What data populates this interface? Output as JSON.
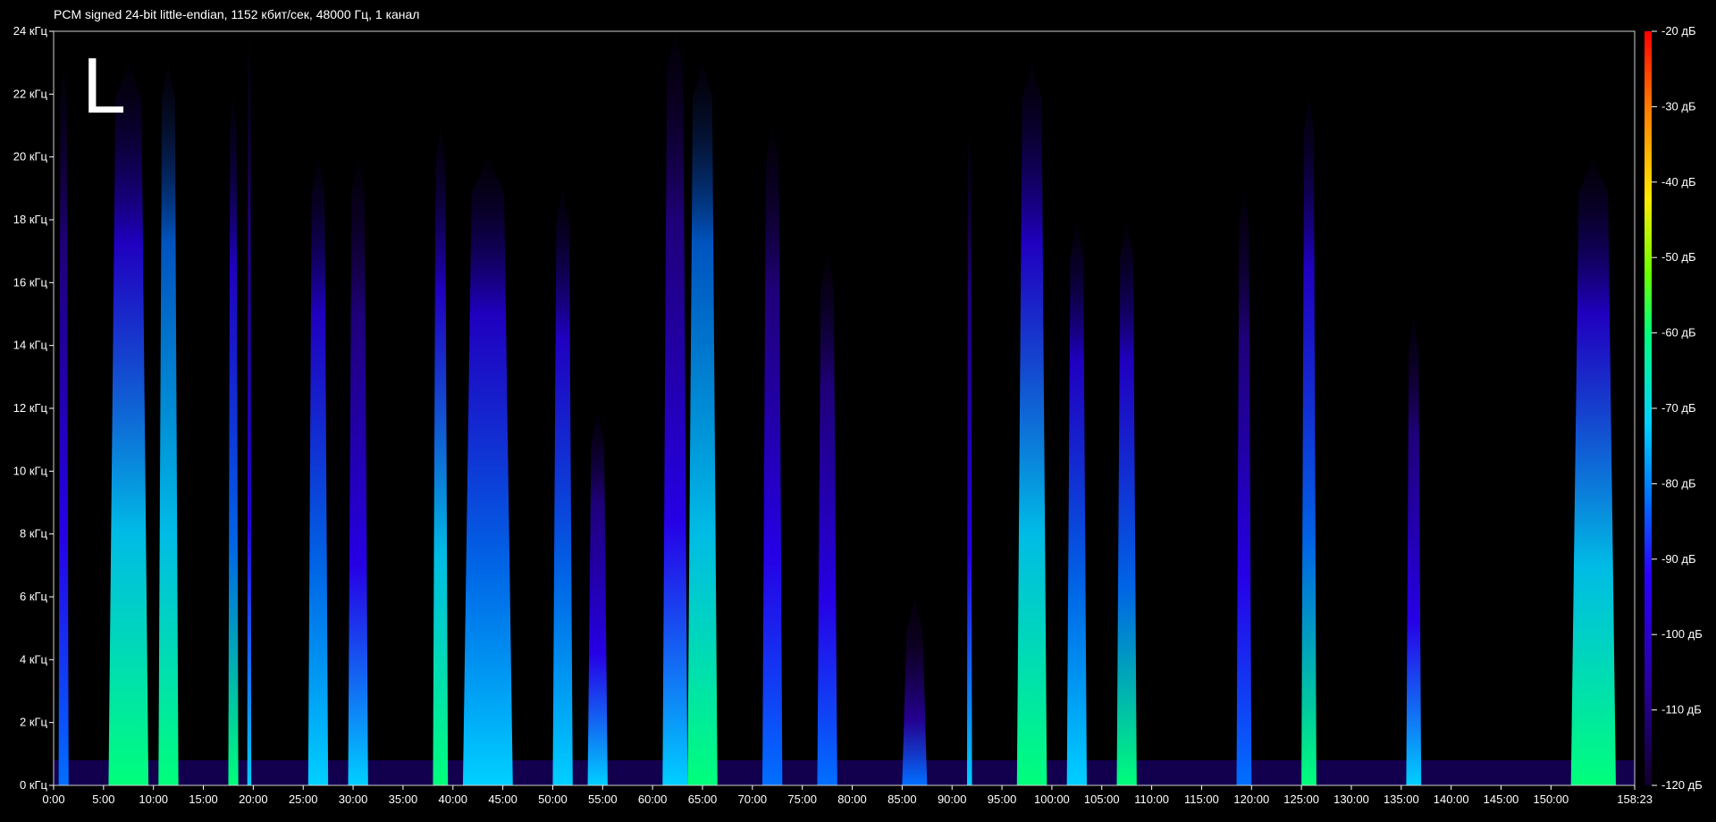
{
  "header": {
    "text": "PCM signed 24-bit little-endian, 1152 кбит/сек, 48000 Гц, 1 канал"
  },
  "channel_label": "L",
  "colors": {
    "background": "#000000",
    "frame": "#cfcfcf"
  },
  "chart_data": {
    "type": "heatmap",
    "title": "PCM signed 24-bit little-endian, 1152 кбит/сек, 48000 Гц, 1 канал",
    "channel": "L",
    "xlabel": "",
    "ylabel": "",
    "x_ticks": [
      "0:00",
      "5:00",
      "10:00",
      "15:00",
      "20:00",
      "25:00",
      "30:00",
      "35:00",
      "40:00",
      "45:00",
      "50:00",
      "55:00",
      "60:00",
      "65:00",
      "70:00",
      "75:00",
      "80:00",
      "85:00",
      "90:00",
      "95:00",
      "100:00",
      "105:00",
      "110:00",
      "115:00",
      "120:00",
      "125:00",
      "130:00",
      "135:00",
      "140:00",
      "145:00",
      "150:00",
      "158:23"
    ],
    "x_tick_minutes": [
      0,
      5,
      10,
      15,
      20,
      25,
      30,
      35,
      40,
      45,
      50,
      55,
      60,
      65,
      70,
      75,
      80,
      85,
      90,
      95,
      100,
      105,
      110,
      115,
      120,
      125,
      130,
      135,
      140,
      145,
      150,
      158.383
    ],
    "xlim_minutes": [
      0,
      158.383
    ],
    "y_ticks": [
      "0 кГц",
      "2 кГц",
      "4 кГц",
      "6 кГц",
      "8 кГц",
      "10 кГц",
      "12 кГц",
      "14 кГц",
      "16 кГц",
      "18 кГц",
      "20 кГц",
      "22 кГц",
      "24 кГц"
    ],
    "y_tick_khz": [
      0,
      2,
      4,
      6,
      8,
      10,
      12,
      14,
      16,
      18,
      20,
      22,
      24
    ],
    "ylim_khz": [
      0,
      24
    ],
    "colorbar": {
      "ticks": [
        "-20 дБ",
        "-30 дБ",
        "-40 дБ",
        "-50 дБ",
        "-60 дБ",
        "-70 дБ",
        "-80 дБ",
        "-90 дБ",
        "-100 дБ",
        "-110 дБ",
        "-120 дБ"
      ],
      "tick_db": [
        -20,
        -30,
        -40,
        -50,
        -60,
        -70,
        -80,
        -90,
        -100,
        -110,
        -120
      ],
      "range_db": [
        -120,
        -20
      ],
      "gradient": [
        "#ff0000",
        "#ff7a00",
        "#ffe800",
        "#6cff00",
        "#00ff7a",
        "#00d0ff",
        "#0070ff",
        "#2a00ff",
        "#2800a0",
        "#10002a"
      ]
    },
    "energy_bursts": [
      {
        "start": 0.5,
        "end": 1.5,
        "max_khz": 23,
        "peak_db": -85
      },
      {
        "start": 5.5,
        "end": 9.5,
        "max_khz": 23,
        "peak_db": -65
      },
      {
        "start": 10.5,
        "end": 12.5,
        "max_khz": 23,
        "peak_db": -62
      },
      {
        "start": 17.5,
        "end": 18.5,
        "max_khz": 22,
        "peak_db": -68
      },
      {
        "start": 19.4,
        "end": 19.8,
        "max_khz": 24,
        "peak_db": -80
      },
      {
        "start": 25.5,
        "end": 27.5,
        "max_khz": 20,
        "peak_db": -75
      },
      {
        "start": 29.5,
        "end": 31.5,
        "max_khz": 20,
        "peak_db": -78
      },
      {
        "start": 38.0,
        "end": 39.5,
        "max_khz": 21,
        "peak_db": -65
      },
      {
        "start": 41.0,
        "end": 46.0,
        "max_khz": 20,
        "peak_db": -70
      },
      {
        "start": 50.0,
        "end": 52.0,
        "max_khz": 19,
        "peak_db": -70
      },
      {
        "start": 53.5,
        "end": 55.5,
        "max_khz": 12,
        "peak_db": -80
      },
      {
        "start": 61.0,
        "end": 63.5,
        "max_khz": 24,
        "peak_db": -80
      },
      {
        "start": 63.5,
        "end": 66.5,
        "max_khz": 23,
        "peak_db": -60
      },
      {
        "start": 71.0,
        "end": 73.0,
        "max_khz": 21,
        "peak_db": -82
      },
      {
        "start": 76.5,
        "end": 78.5,
        "max_khz": 17,
        "peak_db": -85
      },
      {
        "start": 85.0,
        "end": 87.5,
        "max_khz": 6,
        "peak_db": -90
      },
      {
        "start": 91.5,
        "end": 92.0,
        "max_khz": 21,
        "peak_db": -80
      },
      {
        "start": 96.5,
        "end": 99.5,
        "max_khz": 23,
        "peak_db": -65
      },
      {
        "start": 101.5,
        "end": 103.5,
        "max_khz": 18,
        "peak_db": -75
      },
      {
        "start": 106.5,
        "end": 108.5,
        "max_khz": 18,
        "peak_db": -68
      },
      {
        "start": 118.5,
        "end": 120.0,
        "max_khz": 19,
        "peak_db": -82
      },
      {
        "start": 125.0,
        "end": 126.5,
        "max_khz": 22,
        "peak_db": -68
      },
      {
        "start": 135.5,
        "end": 137.0,
        "max_khz": 15,
        "peak_db": -78
      },
      {
        "start": 152.0,
        "end": 156.5,
        "max_khz": 20,
        "peak_db": -65
      }
    ]
  }
}
